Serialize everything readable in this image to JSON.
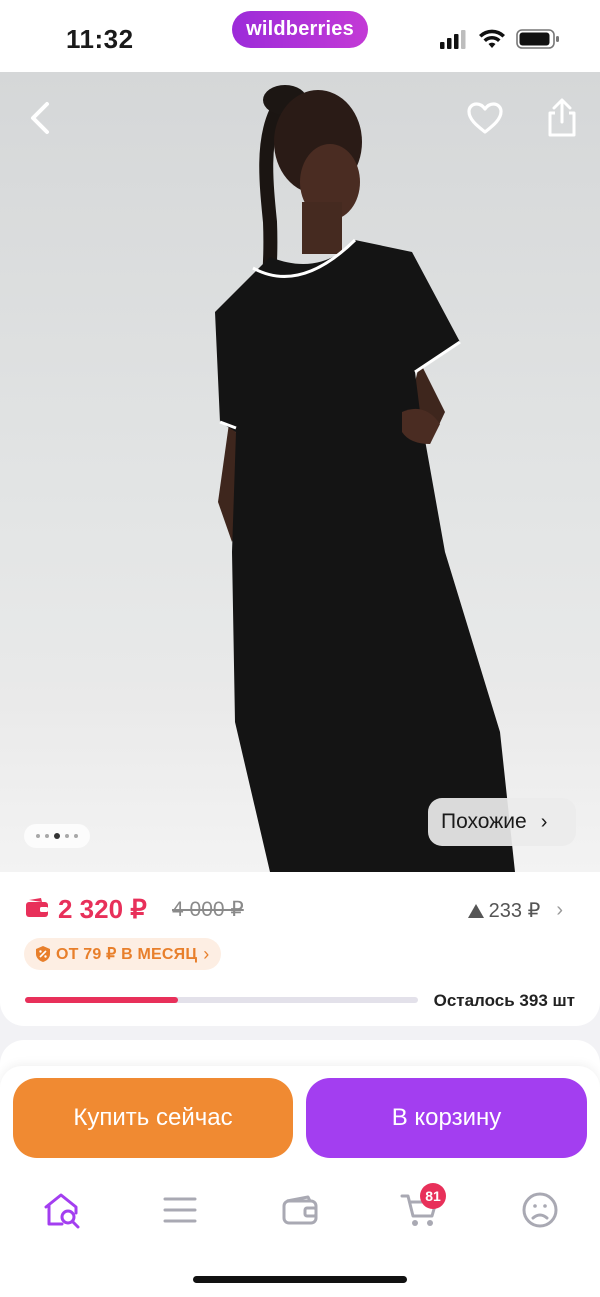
{
  "status_bar": {
    "time": "11:32",
    "brand": "wildberries"
  },
  "gallery": {
    "image_alt": "Model in black midi t-shirt dress with white trim",
    "dot_count": 5,
    "active_dot": 2,
    "similar_label": "Похожие",
    "icons": {
      "back": "chevron-left-icon",
      "favorite": "heart-icon",
      "share": "share-icon"
    }
  },
  "price": {
    "current": "2 320 ₽",
    "old": "4 000 ₽",
    "rating_value": "233 ₽",
    "installment": "ОТ 79 ₽ В МЕСЯЦ",
    "remaining_text": "Осталось 393 шт",
    "stock_fraction": 0.39,
    "accent_color": "#e8305a"
  },
  "actions": {
    "buy_now": "Купить сейчас",
    "add_to_cart": "В корзину"
  },
  "tab_bar": {
    "cart_badge": "81",
    "items": [
      "home-search-icon",
      "menu-icon",
      "wallet-icon",
      "cart-icon",
      "profile-icon"
    ]
  },
  "colors": {
    "buy_now": "#f08a32",
    "add_to_cart": "#a33ef0",
    "brand": "#b033d8"
  }
}
